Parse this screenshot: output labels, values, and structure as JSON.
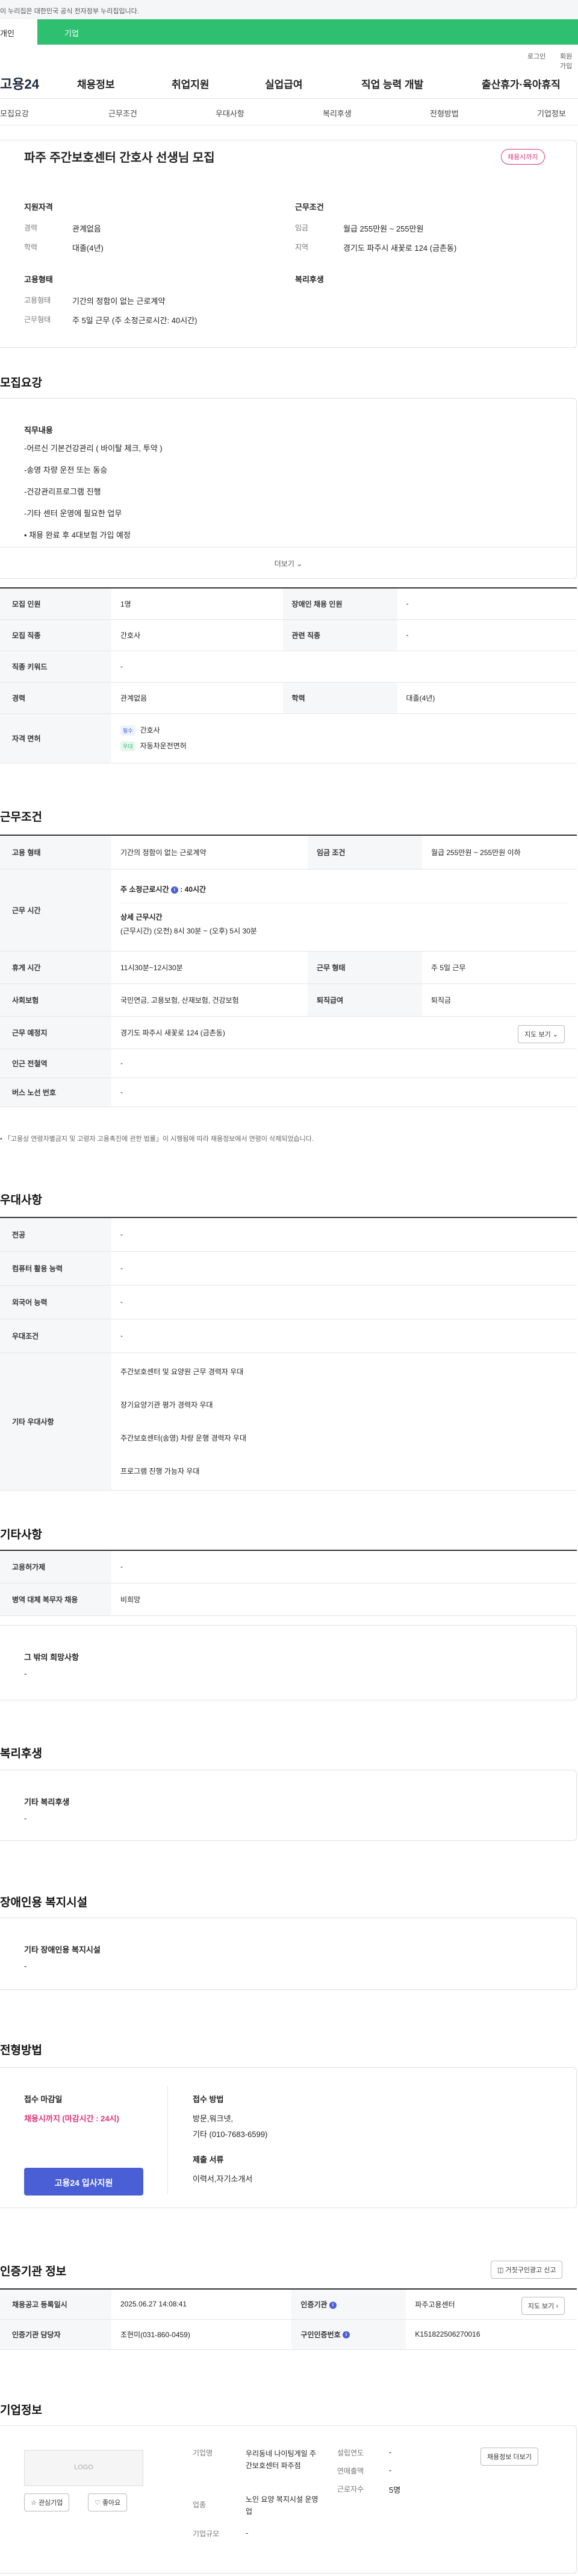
{
  "gov_banner": "이 누리집은 대한민국 공식 전자정부 누리집입니다.",
  "tabs": {
    "personal": "개인",
    "enterprise": "기업"
  },
  "util": {
    "login": "로그인",
    "join": "회원가입"
  },
  "gnb": {
    "logo": "고용24",
    "items": [
      "채용정보",
      "취업지원",
      "실업급여",
      "직업 능력 개발",
      "출산휴가·육아휴직"
    ]
  },
  "snb": [
    "모집요강",
    "근무조건",
    "우대사항",
    "복리후생",
    "전형방법",
    "기업정보"
  ],
  "summary": {
    "title": "파주 주간보호센터 간호사 선생님 모집",
    "deadline_badge": "채용시까지",
    "qual_title": "지원자격",
    "career_label": "경력",
    "career": "관계없음",
    "edu_label": "학력",
    "edu": "대졸(4년)",
    "cond_title": "근무조건",
    "wage_label": "임금",
    "wage": "월급 255만원 ~ 255만원",
    "area_label": "지역",
    "area": "경기도 파주시 새꽃로 124 (금촌동)",
    "emp_title": "고용형태",
    "emptype_label": "고용형태",
    "emptype": "기간의 정함이 없는 근로계약",
    "worktype_label": "근무형태",
    "worktype": "주 5일 근무 (주 소정근로시간: 40시간)",
    "welfare_title": "복리후생"
  },
  "recruit": {
    "heading": "모집요강",
    "duty_title": "직무내용",
    "duties": [
      "-어르신 기본건강관리 ( 바이탈 체크, 투약 )",
      "-송영 차량 운전 또는 동승",
      "-건강관리프로그램 진행",
      "-기타 센터 운영에 필요한 업무",
      "• 채용 완료 후 4대보험 가입 예정"
    ],
    "more": "더보기",
    "rows": {
      "count_label": "모집 인원",
      "count": "1명",
      "disabled_label": "장애인 채용 인원",
      "disabled": "-",
      "job_label": "모집 직종",
      "job": "간호사",
      "related_label": "관련 직종",
      "related": "-",
      "kw_label": "직종 키워드",
      "kw": "-",
      "career_label": "경력",
      "career": "관계없음",
      "edu_label": "학력",
      "edu": "대졸(4년)",
      "license_label": "자격 면허",
      "lic1_tag": "필수",
      "lic1": "간호사",
      "lic2_tag": "우대",
      "lic2": "자동차운전면허"
    }
  },
  "conditions": {
    "heading": "근무조건",
    "emp_label": "고용 형태",
    "emp": "기간의 정함이 없는 근로계약",
    "wage_label": "임금 조건",
    "wage": "월급 255만원 ~ 255만원 이하",
    "hours_label": "근무 시간",
    "weekly": "주 소정근로시간",
    "weekly_val": "40시간",
    "detail_title": "상세 근무시간",
    "detail": "(근무시간) (오전) 8시 30분 ~ (오후) 5시 30분",
    "rest_label": "휴게 시간",
    "rest": "11시30분~12시30분",
    "form_label": "근무 형태",
    "form": "주 5일 근무",
    "ins_label": "사회보험",
    "ins": "국민연금, 고용보험, 산재보험, 건강보험",
    "ret_label": "퇴직급여",
    "ret": "퇴직금",
    "place_label": "근무 예정지",
    "place": "경기도 파주시 새꽃로 124 (금촌동)",
    "map_btn": "지도 보기",
    "station_label": "인근 전철역",
    "station": "-",
    "bus_label": "버스 노선 번호",
    "bus": "-",
    "note": "• 「고용상 연령차별금지 및 고령자 고용촉진에 관한 법률」이 시행됨에 따라 채용정보에서 연령이 삭제되었습니다."
  },
  "pref": {
    "heading": "우대사항",
    "major_label": "전공",
    "major": "-",
    "pc_label": "컴퓨터 활용 능력",
    "pc": "-",
    "lang_label": "외국어 능력",
    "lang": "-",
    "cond_label": "우대조건",
    "cond": "-",
    "etc_label": "기타 우대사항",
    "etc": [
      "주간보호센터 및 요양원 근무 경력자 우대",
      "장기요양기관 평가 경력자 우대",
      "주간보호센터(송영) 차량 운행 경력자 우대",
      "프로그램 진행 가능자 우대"
    ]
  },
  "other": {
    "heading": "기타사항",
    "hire_label": "고용허가제",
    "hire": "-",
    "mil_label": "병역 대체 복무자 채용",
    "mil": "비희망",
    "wish_title": "그 밖의 희망사항",
    "wish": "-"
  },
  "welfare": {
    "heading": "복리후생",
    "title": "기타 복리후생",
    "value": "-"
  },
  "facility": {
    "heading": "장애인용 복지시설",
    "title": "기타 장애인용 복지시설",
    "value": "-"
  },
  "process": {
    "heading": "전형방법",
    "deadline_title": "접수 마감일",
    "deadline": "채용시까지 (마감시간 : 24시)",
    "method_title": "접수 방법",
    "method1": "방문,워크넷,",
    "method2": "기타 (010-7683-6599)",
    "docs_title": "제출 서류",
    "docs": "이력서,자기소개서",
    "apply_btn": "고용24 입사지원"
  },
  "cert": {
    "heading": "인증기관 정보",
    "report_btn": "거짓구인광고 신고",
    "reg_label": "채용공고 등록일시",
    "reg": "2025.06.27 14:08:41",
    "agency_label": "인증기관",
    "agency": "파주고용센터",
    "map_btn": "지도 보기",
    "manager_label": "인증기관 담당자",
    "manager": "조현미(031-860-0459)",
    "num_label": "구인인증번호",
    "num": "K151822506270016"
  },
  "company": {
    "heading": "기업정보",
    "logo": "LOGO",
    "fav": "관심기업",
    "like": "좋아요",
    "name_label": "기업명",
    "name": "우리동네 나이팅게일 주간보호센터 파주점",
    "industry_label": "업종",
    "industry": "노인 요양 복지시설 운영업",
    "size_label": "기업규모",
    "size": "-",
    "year_label": "설립연도",
    "year": "-",
    "sales_label": "연매출액",
    "sales": "-",
    "emp_label": "근로자수",
    "emp": "5명",
    "more_btn": "채용정보 더보기"
  }
}
